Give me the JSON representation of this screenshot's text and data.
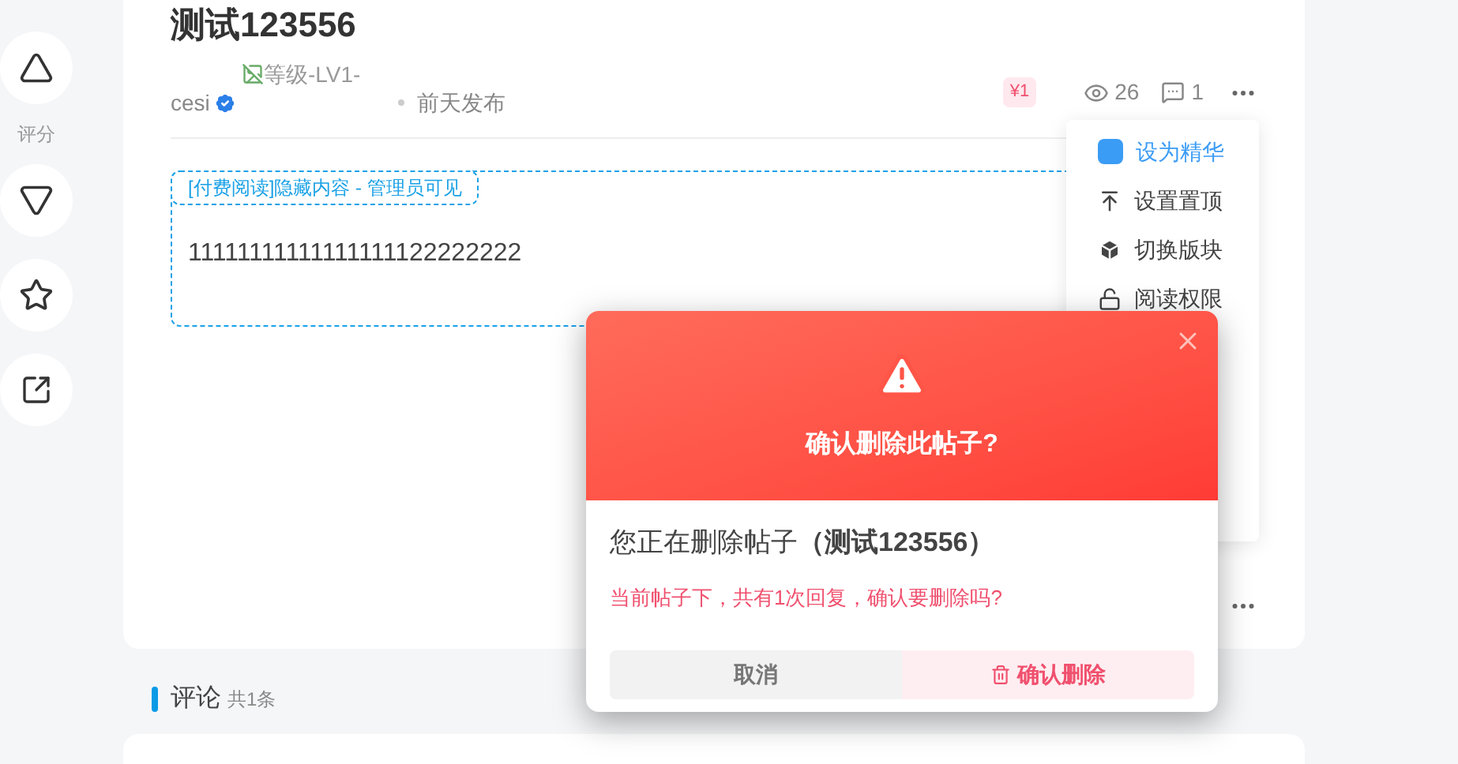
{
  "side_actions": {
    "rating_label": "评分"
  },
  "post": {
    "title": "测试123556",
    "level_image_alt": "等级-LV1-",
    "author": "cesi",
    "verified": true,
    "time": "前天发布",
    "price": "¥1",
    "views": "26",
    "comments": "1",
    "hidden_label": "[付费阅读]隐藏内容 - 管理员可见",
    "hidden_content": "11111111111111111122222222"
  },
  "menu": {
    "items": [
      {
        "label": "设为精华",
        "kind": "essence",
        "highlighted": true
      },
      {
        "label": "设置置顶",
        "kind": "top",
        "highlighted": false
      },
      {
        "label": "切换版块",
        "kind": "cube",
        "highlighted": false
      },
      {
        "label": "阅读权限",
        "kind": "lock",
        "highlighted": false
      }
    ]
  },
  "dialog": {
    "title": "确认删除此帖子?",
    "message": "您正在删除帖子**（测试123556）**",
    "warning": "当前帖子下，共有1次回复，确认要删除吗?",
    "cancel": "取消",
    "confirm": "确认删除"
  },
  "comments_section": {
    "title": "评论",
    "count": "共1条"
  }
}
